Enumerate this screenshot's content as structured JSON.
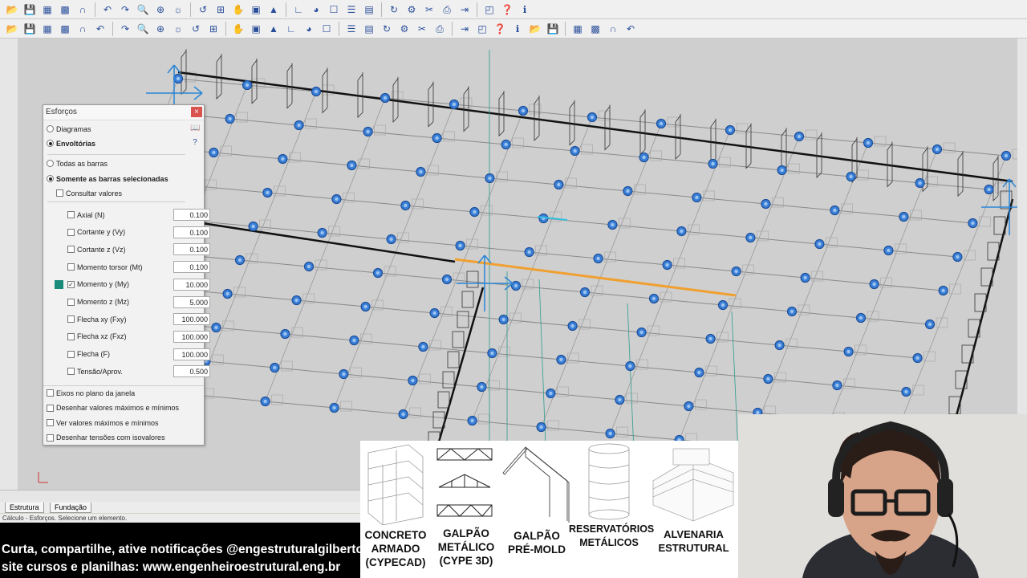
{
  "toolbar_top": {
    "icons": [
      "folder-icon",
      "save-icon",
      "grid-icon",
      "screen-icon",
      "magnet-icon",
      "undo-icon",
      "redo-icon",
      "zoom-window-icon",
      "zoom-realtime-icon",
      "zoom-all-icon",
      "zoom-previous-icon",
      "zoom-plus-icon",
      "pan-icon",
      "zoom-select-icon",
      "render-icon",
      "axes-icon",
      "binoculars-icon",
      "window-icon",
      "list-icon",
      "chart-icon",
      "refresh-icon",
      "settings-icon",
      "cut-icon",
      "print-icon",
      "export-icon",
      "preview-icon",
      "help-icon",
      "info-icon"
    ]
  },
  "toolbar_second": {
    "icons": [
      "new-bar-icon",
      "edit-bar-icon",
      "describe-icon",
      "node-icon",
      "move-icon",
      "split-icon",
      "join-icon",
      "align-icon",
      "grid-icon",
      "snap-icon",
      "select-icon",
      "group-icon",
      "load-icon",
      "support-icon",
      "dimension-icon",
      "line-icon",
      "view-icon",
      "section-icon",
      "calc-icon",
      "results-icon"
    ]
  },
  "panel": {
    "title": "Esforços",
    "close": "×",
    "mode_options": [
      {
        "label": "Diagramas",
        "selected": false
      },
      {
        "label": "Envoltórias",
        "selected": true
      }
    ],
    "bar_options": [
      {
        "label": "Todas as barras",
        "selected": false
      },
      {
        "label": "Somente as barras selecionadas",
        "selected": true
      }
    ],
    "consult_label": "Consultar valores",
    "efforts": [
      {
        "label": "Axial (N)",
        "value": "0.100",
        "checked": false
      },
      {
        "label": "Cortante y (Vy)",
        "value": "0.100",
        "checked": false
      },
      {
        "label": "Cortante z (Vz)",
        "value": "0.100",
        "checked": false
      },
      {
        "label": "Momento torsor (Mt)",
        "value": "0.100",
        "checked": false
      },
      {
        "label": "Momento y (My)",
        "value": "10.000",
        "checked": true
      },
      {
        "label": "Momento z (Mz)",
        "value": "5.000",
        "checked": false
      },
      {
        "label": "Flecha xy (Fxy)",
        "value": "100.000",
        "checked": false
      },
      {
        "label": "Flecha xz (Fxz)",
        "value": "100.000",
        "checked": false
      },
      {
        "label": "Flecha (F)",
        "value": "100.000",
        "checked": false
      },
      {
        "label": "Tensão/Aprov.",
        "value": "0.500",
        "checked": false
      }
    ],
    "options": [
      "Eixos no plano da janela",
      "Desenhar valores máximos e mínimos",
      "Ver valores máximos e mínimos",
      "Desenhar tensões com isovalores"
    ],
    "my_color": "#1a8a7a"
  },
  "tabs": [
    "Estrutura",
    "Fundação"
  ],
  "status_text": "Cálculo - Esforços. Selecione um elemento.",
  "banner": {
    "line1": "Curta, compartilhe, ative notificações @engestruturalgilberto",
    "line2": "site cursos e planilhas: www.engenheiroestrutural.eng.br"
  },
  "courses": [
    {
      "lines": [
        "CONCRETO",
        "ARMADO",
        "(CYPECAD)"
      ]
    },
    {
      "lines": [
        "GALPÃO",
        "METÁLICO",
        "(CYPE 3D)"
      ]
    },
    {
      "lines": [
        "GALPÃO",
        "PRÉ-MOLD"
      ]
    },
    {
      "lines": [
        "RESERVATÓRIOS",
        "METÁLICOS"
      ]
    },
    {
      "lines": [
        "ALVENARIA",
        "ESTRUTURAL"
      ]
    }
  ],
  "colors": {
    "node": "#3a7fd6",
    "selected_bar": "#f0a030",
    "support": "#2a86d6",
    "panel_bg": "#f2f2f2"
  }
}
